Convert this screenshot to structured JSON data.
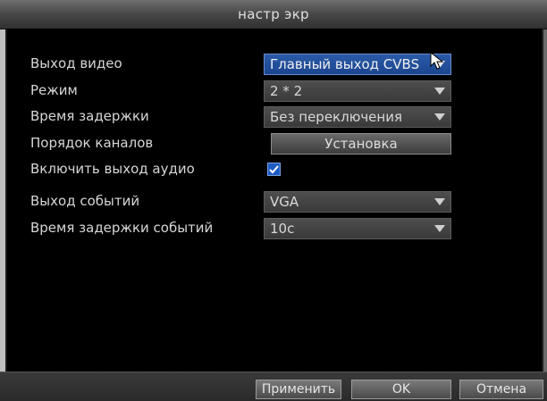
{
  "window": {
    "title": "настр экр"
  },
  "settings": {
    "video_output": {
      "label": "Выход видео",
      "value": "Главный выход CVBS"
    },
    "mode": {
      "label": "Режим",
      "value": "2 * 2"
    },
    "dwell_time": {
      "label": "Время задержки",
      "value": "Без переключения"
    },
    "channel_order": {
      "label": "Порядок каналов",
      "button": "Установка"
    },
    "audio_output": {
      "label": "Включить выход аудио",
      "checked": true
    },
    "event_output": {
      "label": "Выход событий",
      "value": "VGA"
    },
    "event_dwell": {
      "label": "Время задержки событий",
      "value": "10с"
    }
  },
  "buttons": {
    "apply": "Применить",
    "ok": "OK",
    "cancel": "Отмена"
  },
  "colors": {
    "accent": "#1e5cc4",
    "background": "#000000",
    "text": "#d6d6d6"
  },
  "icons": {
    "dropdown": "dropdown-arrow-icon",
    "check": "checkmark-icon",
    "cursor": "mouse-cursor-icon"
  }
}
